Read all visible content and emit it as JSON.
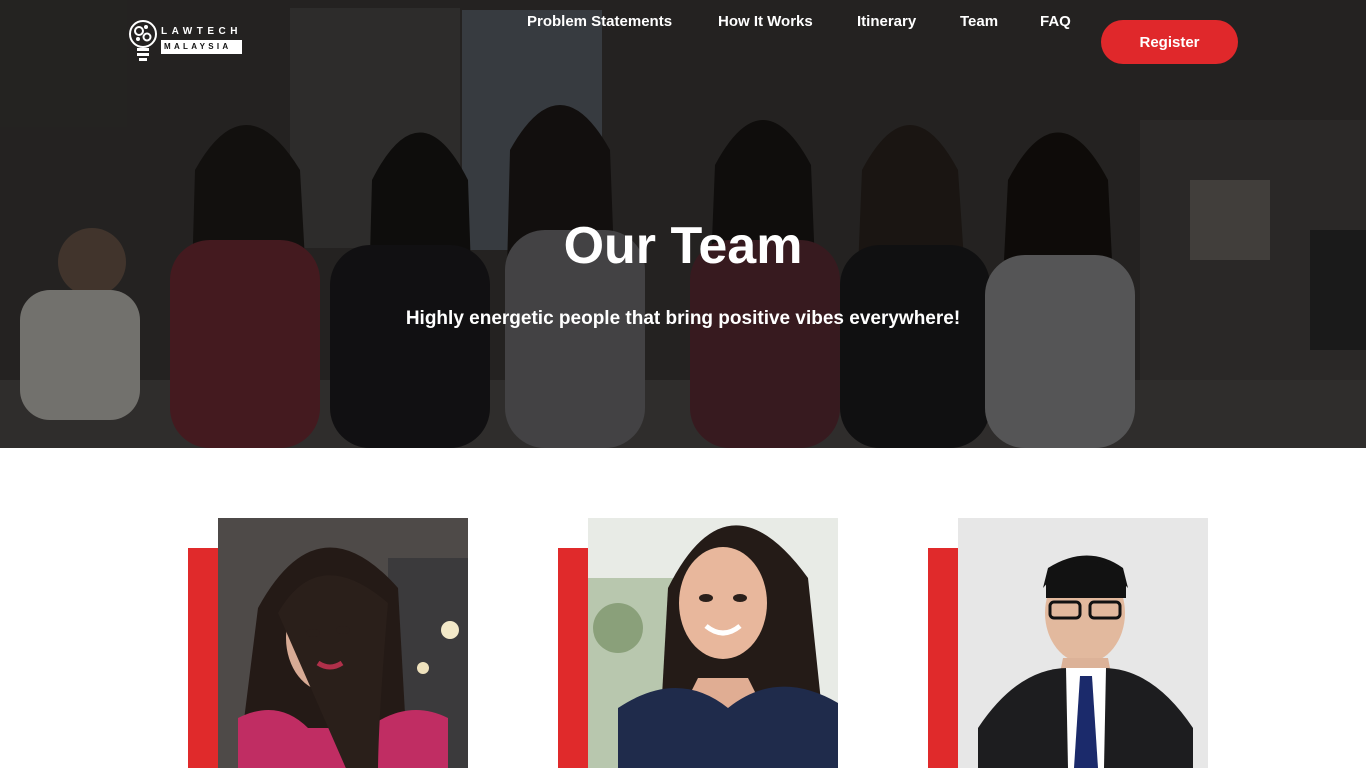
{
  "brand": {
    "logo_top": "LAWTECH",
    "logo_bottom": "MALAYSIA"
  },
  "nav": {
    "items": [
      "Problem Statements",
      "How It Works",
      "Itinerary",
      "Team",
      "FAQ"
    ],
    "register_label": "Register",
    "accent_color": "#e0282b"
  },
  "hero": {
    "title": "Our Team",
    "subtitle": "Highly energetic people that bring positive vibes everywhere!"
  },
  "team_cards": [
    {
      "icon": "portrait-woman-pink-top"
    },
    {
      "icon": "portrait-woman-navy-top"
    },
    {
      "icon": "portrait-man-suit-glasses"
    }
  ]
}
